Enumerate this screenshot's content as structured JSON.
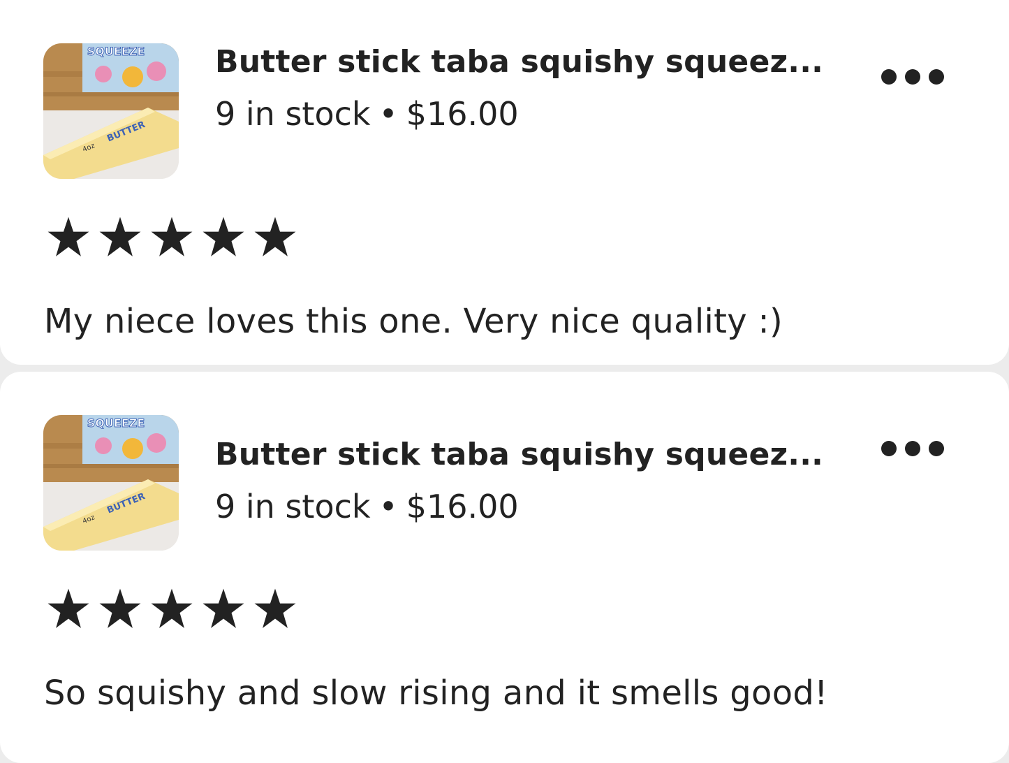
{
  "colors": {
    "background": "#ececec",
    "card": "#ffffff",
    "text": "#222222",
    "star": "#222222",
    "butter": "#f3dc8e",
    "package_blue": "#3c62b5"
  },
  "icons": {
    "rating_star": "star-icon",
    "more_menu": "more-horizontal-icon"
  },
  "reviews": [
    {
      "listing": {
        "thumbnail": "butter-stick-product-photo",
        "thumbnail_text": {
          "package_brand": "SQUEEZE",
          "label": "BUTTER",
          "size": "4oz"
        },
        "title": "Butter stick taba squishy squeez...",
        "stock": "9 in stock",
        "separator": "•",
        "price": "$16.00"
      },
      "rating": 5,
      "text": "My niece loves this one. Very nice quality :)"
    },
    {
      "listing": {
        "thumbnail": "butter-stick-product-photo",
        "thumbnail_text": {
          "package_brand": "SQUEEZE",
          "label": "BUTTER",
          "size": "4oz"
        },
        "title": "Butter stick taba squishy squeez...",
        "stock": "9 in stock",
        "separator": "•",
        "price": "$16.00"
      },
      "rating": 5,
      "text": "So squishy and slow rising and it smells good!"
    }
  ]
}
